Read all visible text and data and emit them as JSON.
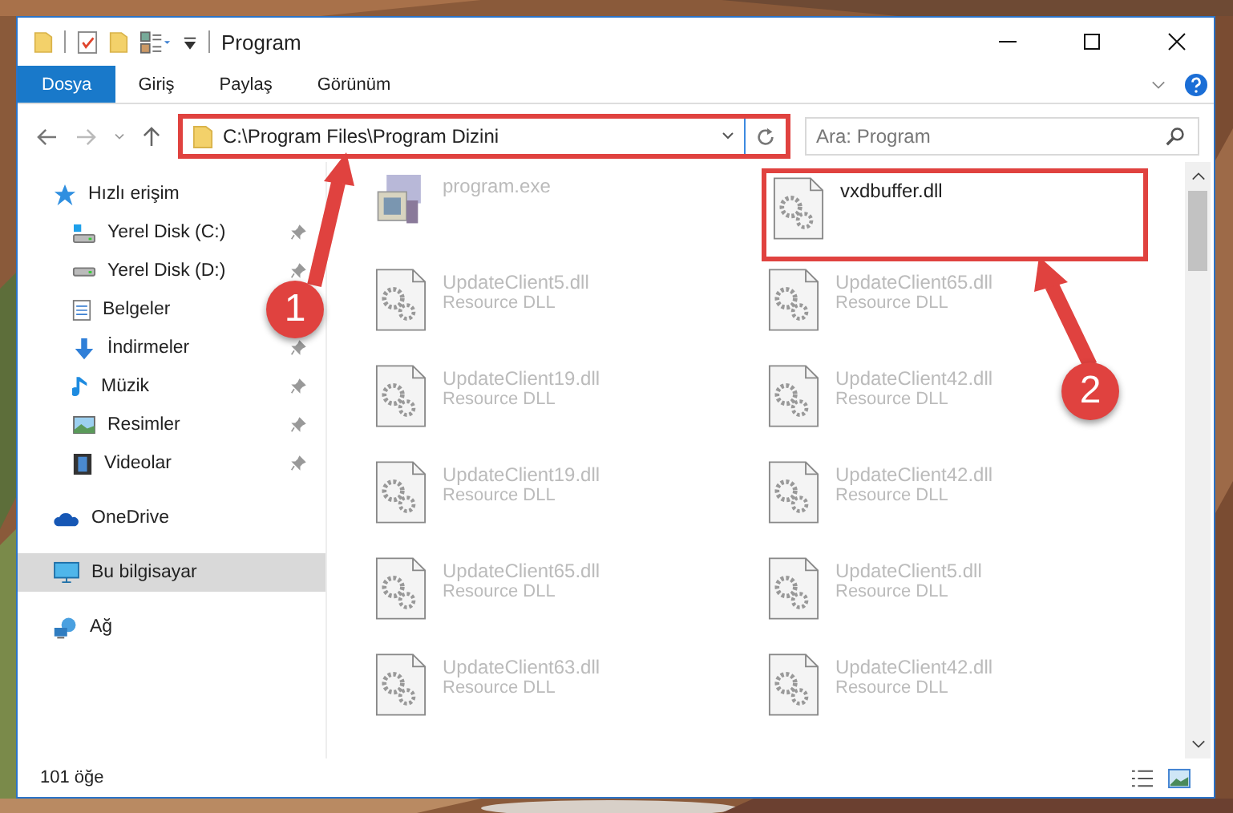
{
  "window": {
    "title": "Program"
  },
  "ribbon_tabs": [
    {
      "label": "Dosya",
      "selected": true
    },
    {
      "label": "Giriş",
      "selected": false
    },
    {
      "label": "Paylaş",
      "selected": false
    },
    {
      "label": "Görünüm",
      "selected": false
    }
  ],
  "address": {
    "path": "C:\\Program Files\\Program Dizini",
    "highlighted": true
  },
  "search": {
    "placeholder": "Ara: Program"
  },
  "sidebar": {
    "items": [
      {
        "label": "Hızlı erişim",
        "kind": "star",
        "selected": false,
        "children": [
          {
            "label": "Yerel Disk (C:)",
            "kind": "drive-c",
            "pinned": true
          },
          {
            "label": "Yerel Disk (D:)",
            "kind": "drive",
            "pinned": true
          },
          {
            "label": "Belgeler",
            "kind": "docs"
          },
          {
            "label": "İndirmeler",
            "kind": "download",
            "pinned": true
          },
          {
            "label": "Müzik",
            "kind": "music",
            "pinned": true
          },
          {
            "label": "Resimler",
            "kind": "pictures",
            "pinned": true
          },
          {
            "label": "Videolar",
            "kind": "videos",
            "pinned": true
          }
        ]
      },
      {
        "label": "OneDrive",
        "kind": "cloud",
        "selected": false
      },
      {
        "label": "Bu bilgisayar",
        "kind": "pc",
        "selected": true
      },
      {
        "label": "Ağ",
        "kind": "network",
        "selected": false
      }
    ]
  },
  "files": [
    {
      "name": "program.exe",
      "kind": "exe",
      "dimmed": true,
      "highlighted": false
    },
    {
      "name": "vxdbuffer.dll",
      "kind": "dll",
      "dimmed": false,
      "highlighted": true
    },
    {
      "name": "UpdateClient5.dll",
      "type": "Resource DLL",
      "kind": "dll",
      "dimmed": true,
      "highlighted": false
    },
    {
      "name": "UpdateClient65.dll",
      "type": "Resource DLL",
      "kind": "dll",
      "dimmed": true,
      "highlighted": false
    },
    {
      "name": "UpdateClient19.dll",
      "type": "Resource DLL",
      "kind": "dll",
      "dimmed": true,
      "highlighted": false
    },
    {
      "name": "UpdateClient42.dll",
      "type": "Resource DLL",
      "kind": "dll",
      "dimmed": true,
      "highlighted": false
    },
    {
      "name": "UpdateClient19.dll",
      "type": "Resource DLL",
      "kind": "dll",
      "dimmed": true,
      "highlighted": false
    },
    {
      "name": "UpdateClient42.dll",
      "type": "Resource DLL",
      "kind": "dll",
      "dimmed": true,
      "highlighted": false
    },
    {
      "name": "UpdateClient65.dll",
      "type": "Resource DLL",
      "kind": "dll",
      "dimmed": true,
      "highlighted": false
    },
    {
      "name": "UpdateClient5.dll",
      "type": "Resource DLL",
      "kind": "dll",
      "dimmed": true,
      "highlighted": false
    },
    {
      "name": "UpdateClient63.dll",
      "type": "Resource DLL",
      "kind": "dll",
      "dimmed": true,
      "highlighted": false
    },
    {
      "name": "UpdateClient42.dll",
      "type": "Resource DLL",
      "kind": "dll",
      "dimmed": true,
      "highlighted": false
    }
  ],
  "callouts": [
    {
      "number": "1"
    },
    {
      "number": "2"
    }
  ],
  "status_bar": {
    "item_count": "101 öğe"
  }
}
